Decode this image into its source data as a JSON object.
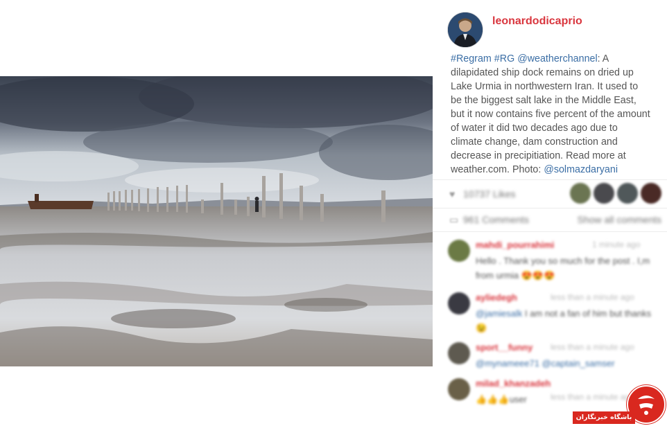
{
  "post": {
    "username": "leonardodicaprio",
    "caption": {
      "tags": [
        "#Regram",
        "#RG",
        "@weatherchannel"
      ],
      "text_after_tags": ": A dilapidated ship dock remains on dried up Lake Urmia in northwestern Iran. It used to be the biggest salt lake in the Middle East, but it now contains five percent of the amount of water it did two decades ago due to climate change, dam construction and decrease in precipitiation. Read more at weather.com. Photo: ",
      "photo_credit": "@solmazdaryani"
    },
    "likes_text": "10737 Likes",
    "comments_text": "961 Comments",
    "show_all_label": "Show all comments"
  },
  "comments": [
    {
      "user": "mahdi_pourrahimi",
      "time": "1 minute ago",
      "text": "Hello . Thank you so much for the post . I,m from urmia",
      "mention": "",
      "emoji": "😍😍😍",
      "avatar_color": "#6b7a45"
    },
    {
      "user": "ayliedegh",
      "time": "less than a minute ago",
      "text": " I am not a fan of him but thanks",
      "mention": "@jamiesalk",
      "emoji": "😉",
      "avatar_color": "#3a3a42"
    },
    {
      "user": "sport__funny",
      "time": "less than a minute ago",
      "text": " ",
      "mention": "@mynameee71 @captain_samser",
      "emoji": "",
      "avatar_color": "#5e5a50"
    },
    {
      "user": "milad_khanzadeh",
      "time": "less than a minute ago",
      "text": "user",
      "mention": "",
      "emoji": "👍👍👍",
      "avatar_color": "#6a6048"
    }
  ],
  "watermark": {
    "label": "باشگاه خبرنگاران"
  },
  "colors": {
    "username": "#d9363e",
    "link": "#3b6ea5",
    "caption_text": "#555555",
    "watermark_red": "#d9281f"
  }
}
